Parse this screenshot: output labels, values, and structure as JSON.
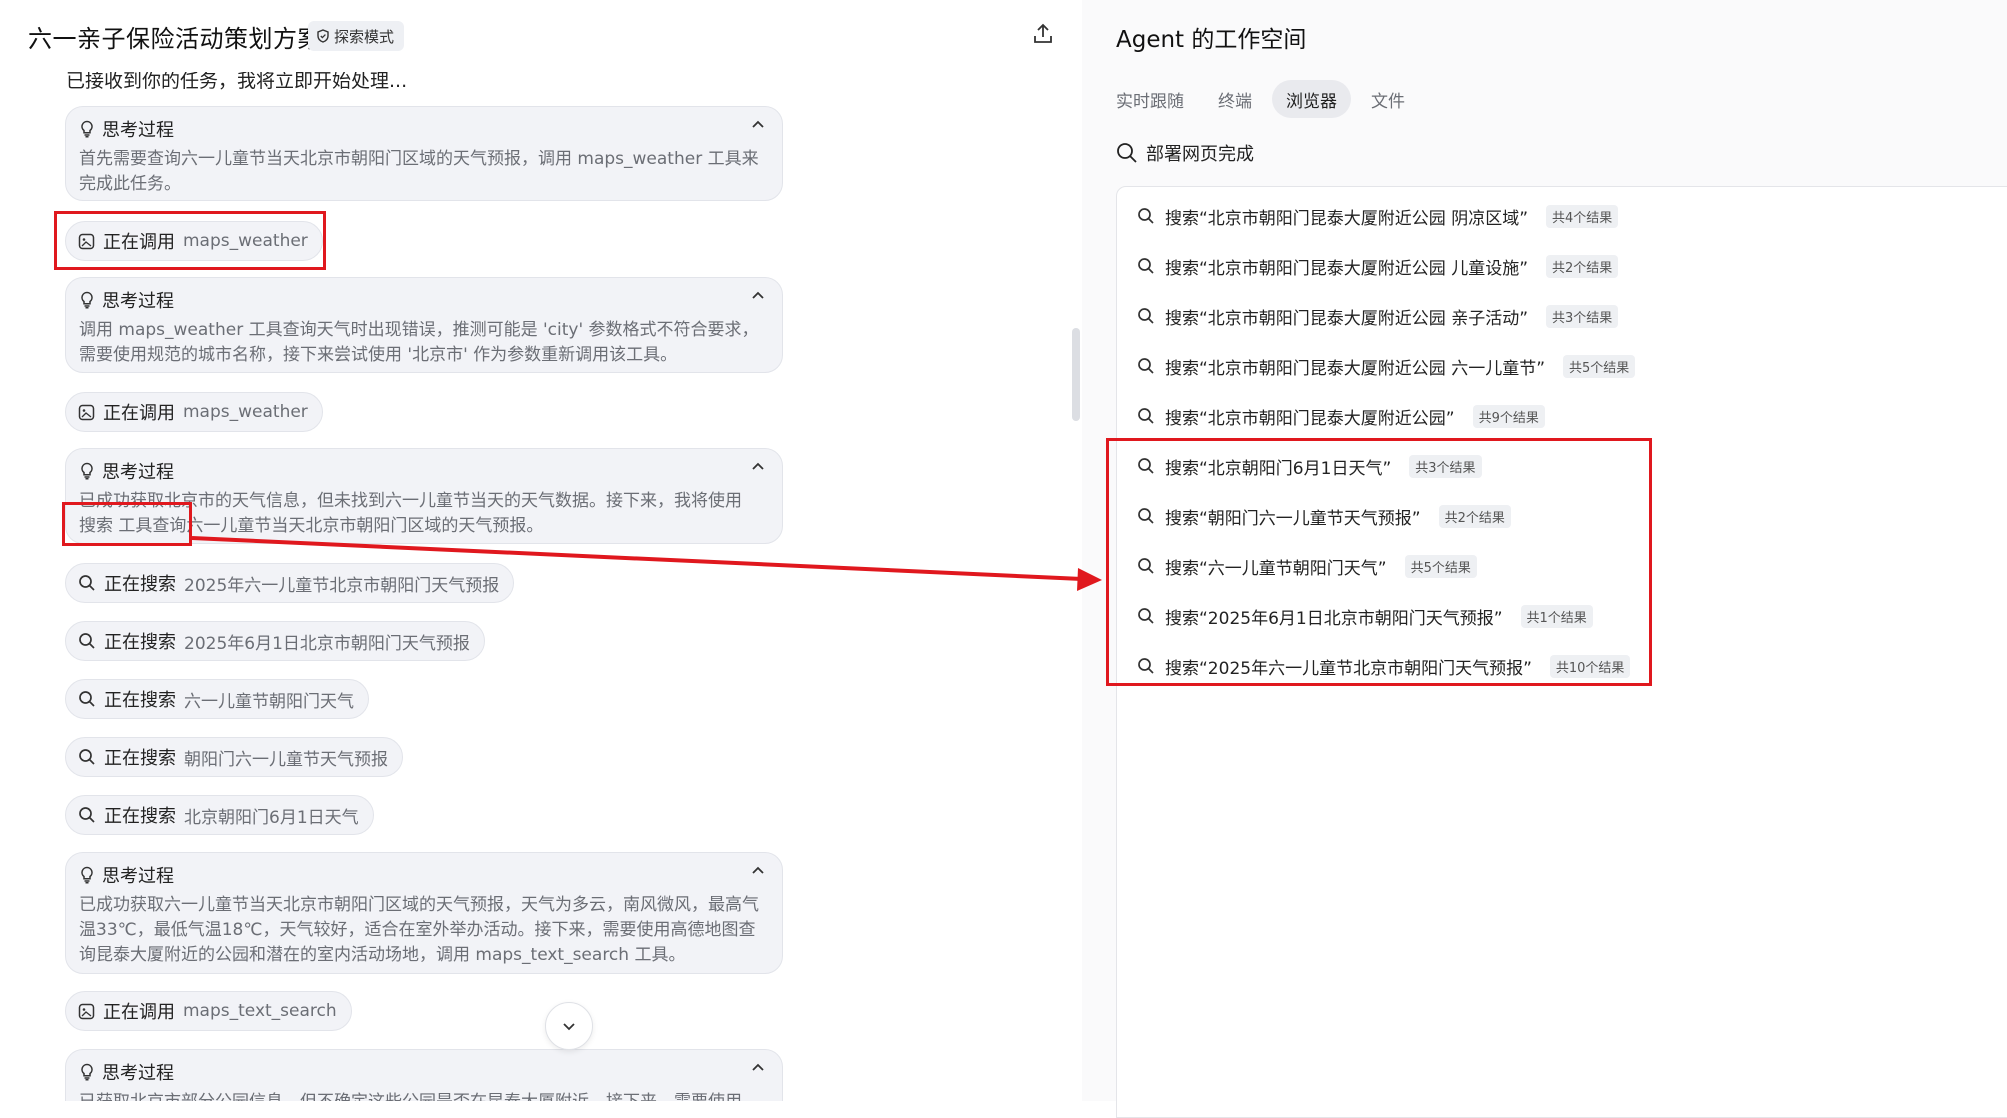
{
  "header": {
    "title": "六一亲子保险活动策划方案",
    "mode_badge": "探索模式",
    "share_icon": "share-upload-icon"
  },
  "chat": {
    "cut_text": "已接收到你的任务，我将立即开始处理...",
    "thinking_label": "思考过程",
    "thinking": [
      {
        "text": "首先需要查询六一儿童节当天北京市朝阳门区域的天气预报，调用 maps_weather 工具来完成此任务。"
      },
      {
        "text": "调用 maps_weather 工具查询天气时出现错误，推测可能是 'city' 参数格式不符合要求，需要使用规范的城市名称，接下来尝试使用 '北京市' 作为参数重新调用该工具。"
      },
      {
        "text": "已成功获取北京市的天气信息，但未找到六一儿童节当天的天气数据。接下来，我将使用 搜索 工具查询六一儿童节当天北京市朝阳门区域的天气预报。"
      },
      {
        "text": "已成功获取六一儿童节当天北京市朝阳门区域的天气预报，天气为多云，南风微风，最高气温33℃，最低气温18℃，天气较好，适合在室外举办活动。接下来，需要使用高德地图查询昆泰大厦附近的公园和潜在的室内活动场地，调用 maps_text_search 工具。"
      },
      {
        "text": "已获取北京市部分公园信息，但不确定这些公园是否在昆泰大厦附近，接下来，需要使用"
      }
    ],
    "calls": [
      {
        "verb": "正在调用",
        "arg": "maps_weather"
      },
      {
        "verb": "正在调用",
        "arg": "maps_weather"
      },
      {
        "verb": "正在调用",
        "arg": "maps_text_search"
      }
    ],
    "searches": [
      {
        "verb": "正在搜索",
        "arg": "2025年六一儿童节北京市朝阳门天气预报"
      },
      {
        "verb": "正在搜索",
        "arg": "2025年6月1日北京市朝阳门天气预报"
      },
      {
        "verb": "正在搜索",
        "arg": "六一儿童节朝阳门天气"
      },
      {
        "verb": "正在搜索",
        "arg": "朝阳门六一儿童节天气预报"
      },
      {
        "verb": "正在搜索",
        "arg": "北京朝阳门6月1日天气"
      }
    ]
  },
  "agent": {
    "title": "Agent 的工作空间",
    "tabs": [
      {
        "label": "实时跟随",
        "active": false
      },
      {
        "label": "终端",
        "active": false
      },
      {
        "label": "浏览器",
        "active": true
      },
      {
        "label": "文件",
        "active": false
      }
    ],
    "status": "部署网页完成",
    "results": [
      {
        "query": "搜索“北京市朝阳门昆泰大厦附近公园 阴凉区域”",
        "count": "共4个结果"
      },
      {
        "query": "搜索“北京市朝阳门昆泰大厦附近公园 儿童设施”",
        "count": "共2个结果"
      },
      {
        "query": "搜索“北京市朝阳门昆泰大厦附近公园 亲子活动”",
        "count": "共3个结果"
      },
      {
        "query": "搜索“北京市朝阳门昆泰大厦附近公园 六一儿童节”",
        "count": "共5个结果"
      },
      {
        "query": "搜索“北京市朝阳门昆泰大厦附近公园”",
        "count": "共9个结果"
      },
      {
        "query": "搜索“北京朝阳门6月1日天气”",
        "count": "共3个结果"
      },
      {
        "query": "搜索“朝阳门六一儿童节天气预报”",
        "count": "共2个结果"
      },
      {
        "query": "搜索“六一儿童节朝阳门天气”",
        "count": "共5个结果"
      },
      {
        "query": "搜索“2025年6月1日北京市朝阳门天气预报”",
        "count": "共1个结果"
      },
      {
        "query": "搜索“2025年六一儿童节北京市朝阳门天气预报”",
        "count": "共10个结果"
      }
    ]
  },
  "colors": {
    "annotation_red": "#e0181e",
    "chip_bg": "#f2f3f7",
    "active_tab_bg": "#e9eaee"
  }
}
